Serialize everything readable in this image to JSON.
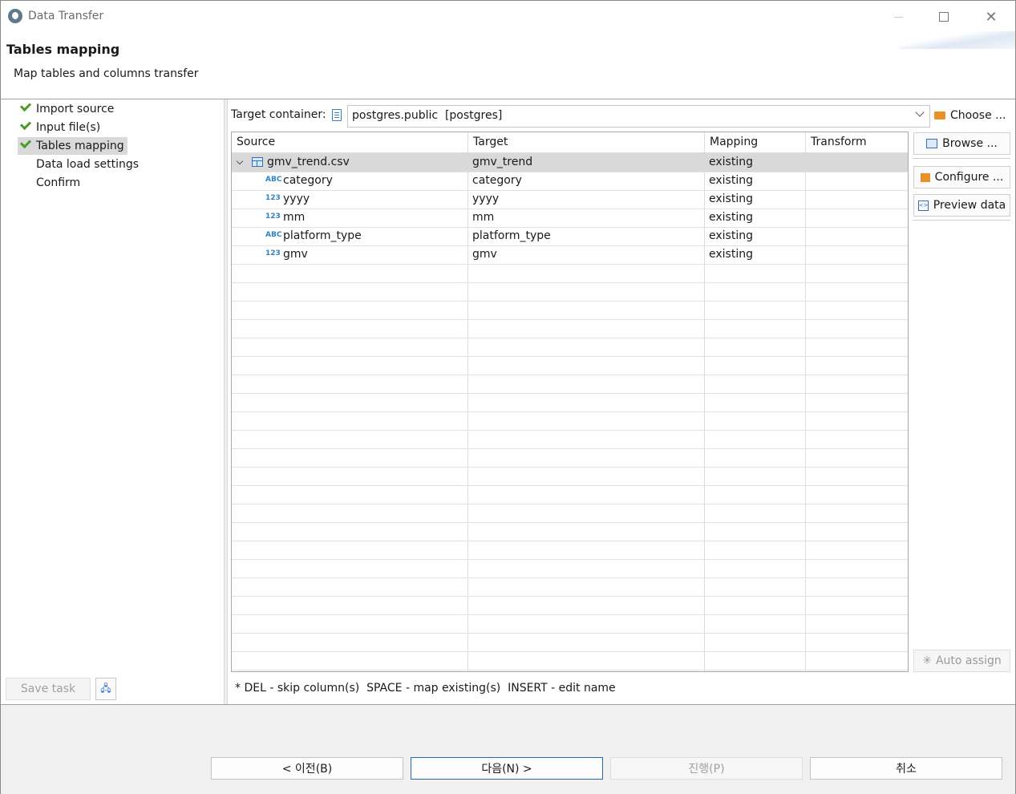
{
  "window": {
    "title": "Data Transfer"
  },
  "header": {
    "title": "Tables mapping",
    "description": "Map tables and columns transfer"
  },
  "nav": {
    "items": [
      {
        "label": "Import source",
        "done": true
      },
      {
        "label": "Input file(s)",
        "done": true
      },
      {
        "label": "Tables mapping",
        "done": true,
        "selected": true
      },
      {
        "label": "Data load settings",
        "done": false
      },
      {
        "label": "Confirm",
        "done": false
      }
    ],
    "save_task": "Save task"
  },
  "target": {
    "label": "Target container:",
    "value": "postgres.public  [postgres]",
    "choose": "Choose ..."
  },
  "table": {
    "columns": [
      "Source",
      "Target",
      "Mapping",
      "Transform"
    ],
    "rows": [
      {
        "source": "gmv_trend.csv",
        "target": "gmv_trend",
        "mapping": "existing",
        "transform": "",
        "type": "table"
      },
      {
        "source": "category",
        "target": "category",
        "mapping": "existing",
        "transform": "",
        "type": "ABC"
      },
      {
        "source": "yyyy",
        "target": "yyyy",
        "mapping": "existing",
        "transform": "",
        "type": "123"
      },
      {
        "source": "mm",
        "target": "mm",
        "mapping": "existing",
        "transform": "",
        "type": "123"
      },
      {
        "source": "platform_type",
        "target": "platform_type",
        "mapping": "existing",
        "transform": "",
        "type": "ABC"
      },
      {
        "source": "gmv",
        "target": "gmv",
        "mapping": "existing",
        "transform": "",
        "type": "123"
      }
    ]
  },
  "side_buttons": {
    "browse": "Browse ...",
    "configure": "Configure ...",
    "preview": "Preview data",
    "auto_assign": "Auto assign"
  },
  "hint": "* DEL - skip column(s)  SPACE - map existing(s)  INSERT - edit name",
  "footer": {
    "back": "< 이전(B)",
    "next": "다음(N) >",
    "proceed": "진행(P)",
    "cancel": "취소"
  }
}
